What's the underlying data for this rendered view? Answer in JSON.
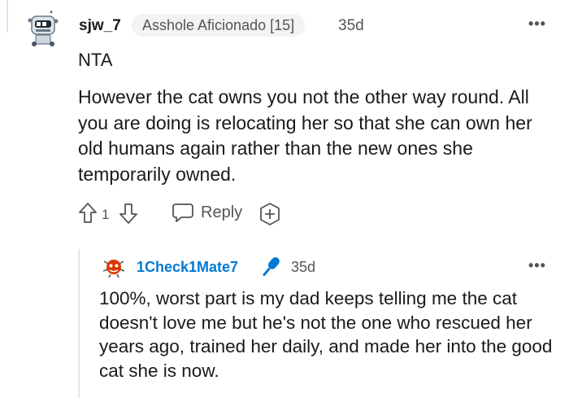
{
  "comment": {
    "author": "sjw_7",
    "flair": "Asshole Aficionado [15]",
    "age": "35d",
    "more": "•••",
    "verdict": "NTA",
    "body": "However the cat owns you not the other way round. All you are doing is relocating her so that she can own her old humans again rather than the new ones she temporarily owned.",
    "votes": "1",
    "reply_label": "Reply",
    "icons": [
      "snoo-robot-avatar-icon",
      "upvote-icon",
      "downvote-icon",
      "reply-bubble-icon",
      "award-plus-icon",
      "more-options-icon"
    ]
  },
  "reply": {
    "author": "1Check1Mate7",
    "age": "35d",
    "more": "•••",
    "body": "100%, worst part is my dad keeps telling me the cat doesn't love me but he's not the one who rescued her years ago, trained her daily, and made her into the good cat she is now.",
    "icons": [
      "reply-avatar-icon",
      "microphone-icon",
      "more-options-icon"
    ],
    "author_color": "#0079d3"
  }
}
